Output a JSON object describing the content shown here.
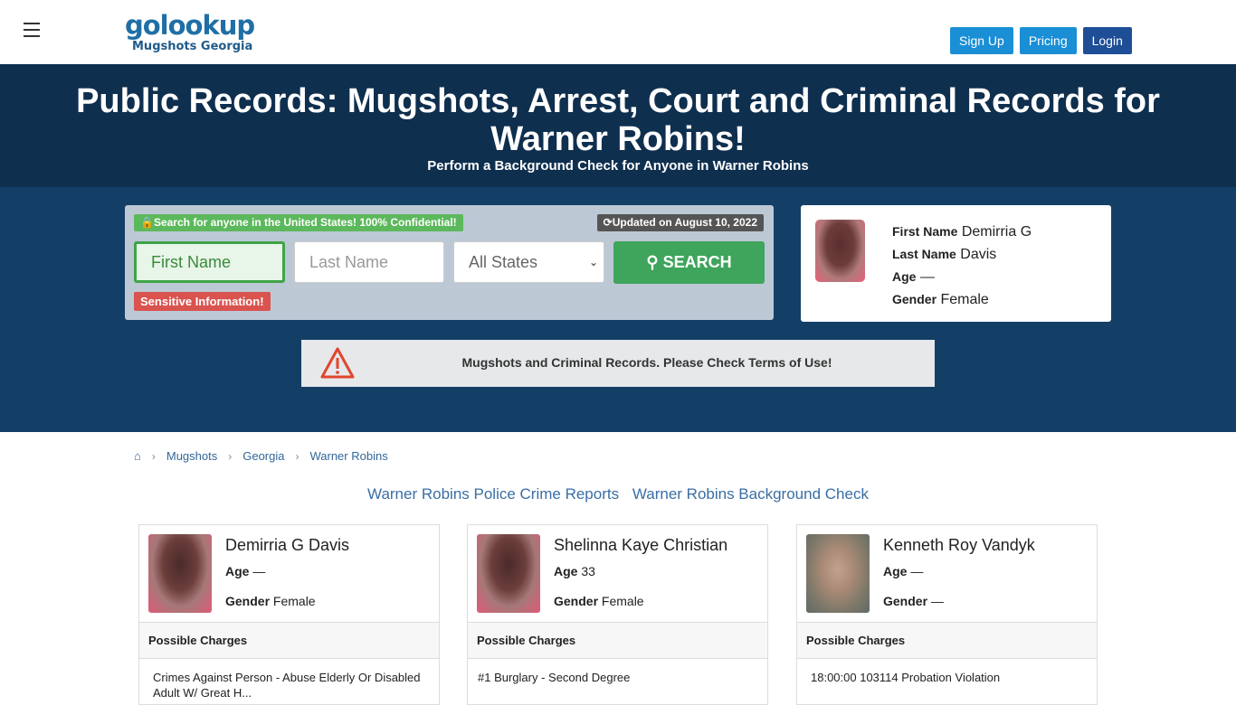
{
  "header": {
    "logo_main": "golookup",
    "logo_sub": "Mugshots Georgia",
    "signup": "Sign Up",
    "pricing": "Pricing",
    "login": "Login"
  },
  "hero": {
    "title": "Public Records: Mugshots, Arrest, Court and Criminal Records for Warner Robins!",
    "subtitle": "Perform a Background Check for Anyone in Warner Robins"
  },
  "search": {
    "confidential_badge": "Search for anyone in the United States! 100% Confidential!",
    "updated_badge": "Updated on August 10, 2022",
    "first_name_placeholder": "First Name",
    "last_name_placeholder": "Last Name",
    "state_selected": "All States",
    "search_button": "SEARCH",
    "sensitive_badge": "Sensitive Information!"
  },
  "profile": {
    "first_name_label": "First Name",
    "first_name": "Demirria G",
    "last_name_label": "Last Name",
    "last_name": "Davis",
    "age_label": "Age",
    "age": "—",
    "gender_label": "Gender",
    "gender": "Female"
  },
  "notice": {
    "text": "Mugshots and Criminal Records. Please Check Terms of Use!"
  },
  "breadcrumb": [
    "Mugshots",
    "Georgia",
    "Warner Robins"
  ],
  "links": [
    "Warner Robins Police Crime Reports",
    "Warner Robins Background Check"
  ],
  "cards": [
    {
      "name": "Demirria G Davis",
      "age_label": "Age",
      "age": "—",
      "gender_label": "Gender",
      "gender": "Female",
      "charges_label": "Possible Charges",
      "charge": "Crimes Against Person - Abuse Elderly Or Disabled Adult W/ Great H..."
    },
    {
      "name": "Shelinna Kaye Christian",
      "age_label": "Age",
      "age": "33",
      "gender_label": "Gender",
      "gender": "Female",
      "charges_label": "Possible Charges",
      "charge": "#1 Burglary - Second Degree"
    },
    {
      "name": "Kenneth Roy Vandyk",
      "age_label": "Age",
      "age": "—",
      "gender_label": "Gender",
      "gender": "—",
      "charges_label": "Possible Charges",
      "charge": "18:00:00 103114 Probation Violation"
    }
  ]
}
